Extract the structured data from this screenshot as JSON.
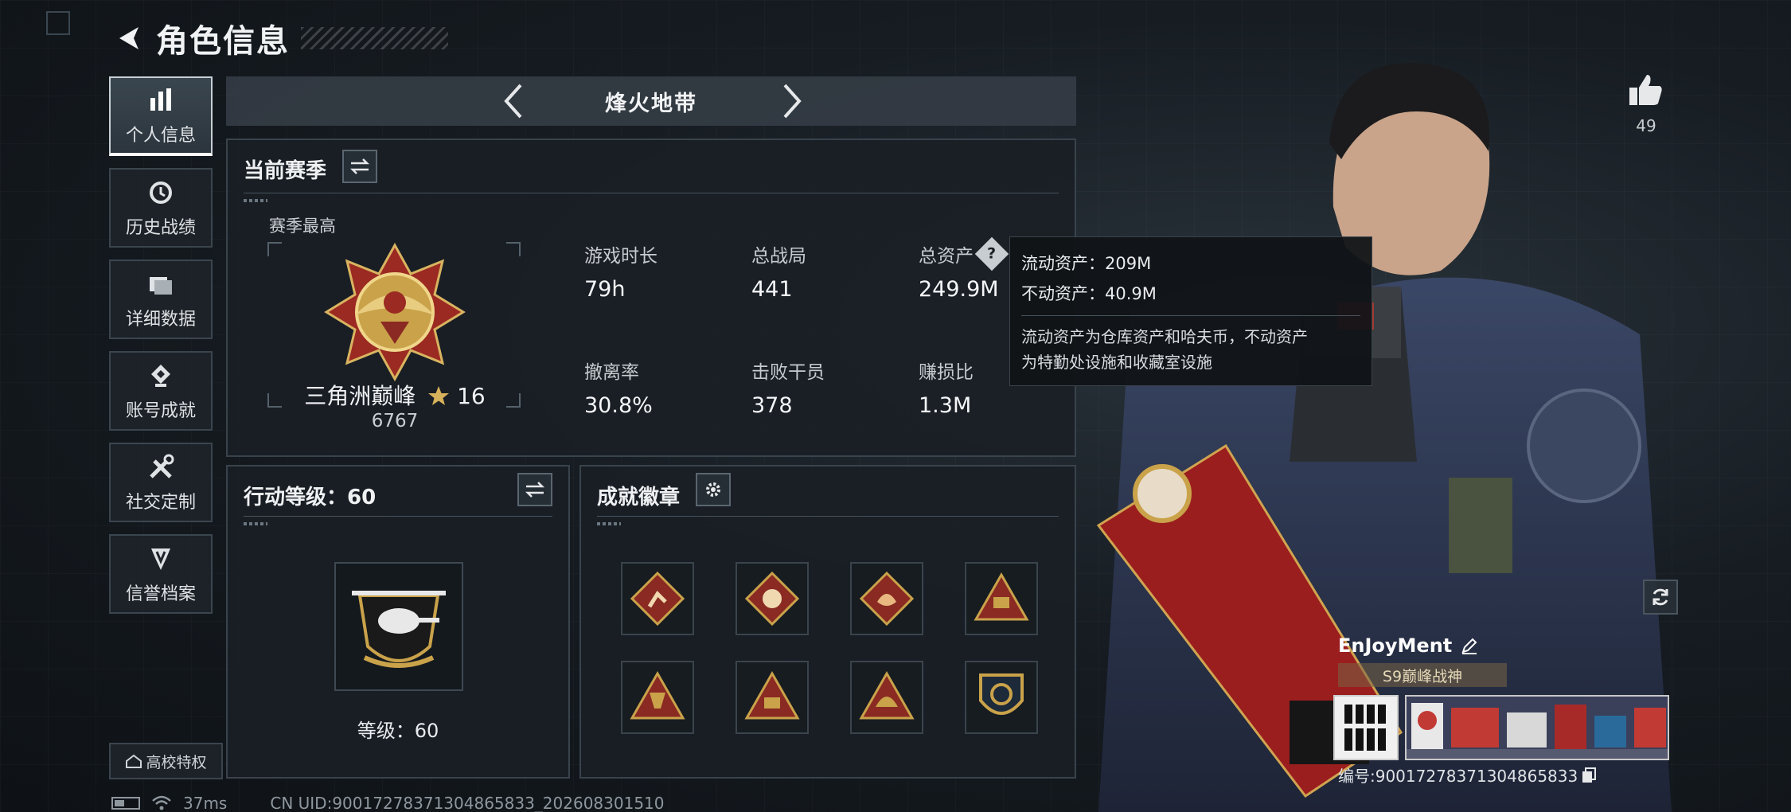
{
  "header": {
    "title": "角色信息"
  },
  "nav": {
    "items": [
      {
        "label": "个人信息",
        "icon": "bar-chart-icon",
        "active": true
      },
      {
        "label": "历史战绩",
        "icon": "history-icon",
        "active": false
      },
      {
        "label": "详细数据",
        "icon": "folder-icon",
        "active": false
      },
      {
        "label": "账号成就",
        "icon": "achievement-icon",
        "active": false
      },
      {
        "label": "社交定制",
        "icon": "tools-icon",
        "active": false
      },
      {
        "label": "信誉档案",
        "icon": "reputation-icon",
        "active": false
      }
    ],
    "campus_label": "高校特权"
  },
  "mode": {
    "title": "烽火地带"
  },
  "season": {
    "title": "当前赛季",
    "best_label": "赛季最高",
    "rank_name": "三角洲巅峰",
    "rank_stars": "16",
    "rank_score": "6767",
    "stats": [
      {
        "label": "游戏时长",
        "value": "79h"
      },
      {
        "label": "总战局",
        "value": "441"
      },
      {
        "label": "总资产",
        "value": "249.9M"
      },
      {
        "label": "撤离率",
        "value": "30.8%"
      },
      {
        "label": "击败干员",
        "value": "378"
      },
      {
        "label": "赚损比",
        "value": "1.3M"
      }
    ]
  },
  "tooltip": {
    "liquid": "流动资产：209M",
    "fixed": "不动资产：40.9M",
    "desc_line1": "流动资产为仓库资产和哈夫币，不动资产",
    "desc_line2": "为特勤处设施和收藏室设施"
  },
  "level": {
    "title": "行动等级：60",
    "label": "等级：60",
    "value": 60
  },
  "badges": {
    "title": "成就徽章",
    "items": [
      "badge-runner",
      "badge-beast",
      "badge-dragon",
      "badge-s5",
      "badge-s5-gold",
      "badge-s6",
      "badge-helmet",
      "badge-emblem"
    ]
  },
  "profile": {
    "like_count": "49",
    "name": "EnJoyMent",
    "title": "S9巅峰战神",
    "id_text": "编号:90017278371304865833"
  },
  "status": {
    "ping": "37ms",
    "uid": "CN UID:90017278371304865833_202608301510"
  },
  "colors": {
    "accent_gold": "#c9a24a",
    "panel_border": "#39434c",
    "badge_red": "#8a2a22"
  }
}
